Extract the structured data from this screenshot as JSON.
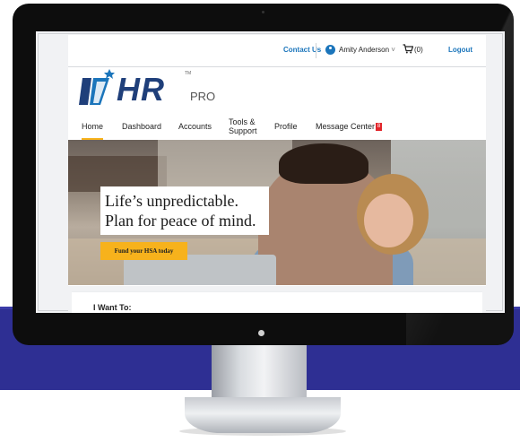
{
  "header": {
    "contact_us": "Contact Us",
    "user_name": "Amity Anderson",
    "user_caret": "˅",
    "cart_count": "(0)",
    "logout": "Logout"
  },
  "logo": {
    "text_main": "HR",
    "text_sub": "PRO",
    "tm": "TM"
  },
  "nav": {
    "items": [
      {
        "label": "Home",
        "active": true
      },
      {
        "label": "Dashboard"
      },
      {
        "label": "Accounts"
      },
      {
        "label": "Tools &"
      },
      {
        "label": "Support"
      },
      {
        "label": "Profile"
      },
      {
        "label": "Message Center"
      }
    ],
    "message_badge": "8"
  },
  "hero": {
    "line1": "Life’s unpredictable.",
    "line2": "Plan for peace of mind.",
    "button": "Fund your HSA today"
  },
  "main": {
    "i_want_to": "I Want To:"
  },
  "colors": {
    "brand_blue": "#1b75bb",
    "accent_yellow": "#f7b21c",
    "badge_red": "#e2262b",
    "logo_navy": "#1f3f7a",
    "band_blue": "#2e2f93"
  }
}
